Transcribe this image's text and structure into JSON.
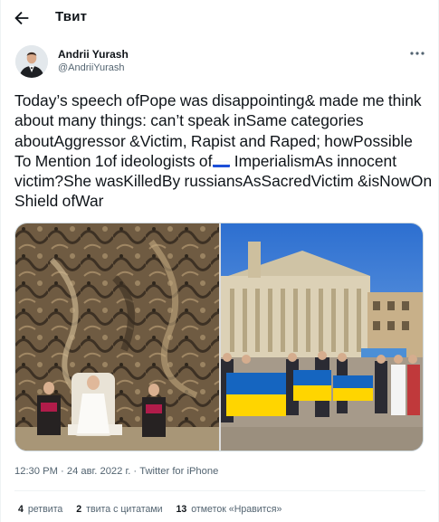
{
  "header": {
    "title": "Твит"
  },
  "author": {
    "name": "Andrii Yurash",
    "handle": "@AndriiYurash"
  },
  "tweet": {
    "text_main": "Today’s speech ofPope was disappointing& made me think about many things: can’t speak inSame categories aboutAggressor &Victim, Rapist and Raped; howPossible To Mention 1of ideologists of",
    "text_tail": " ImperialismAs innocent victim?She wasKilledBy russiansAsSacredVictim &isNowOn Shield ofWar"
  },
  "meta": {
    "time": "12:30 PM",
    "date": "24 авг. 2022 г.",
    "separator": " · ",
    "source": "Twitter for iPhone"
  },
  "stats": {
    "retweets_count": "4",
    "retweets_label": "ретвита",
    "quotes_count": "2",
    "quotes_label": "твита с цитатами",
    "likes_count": "13",
    "likes_label": "отметок «Нравится»"
  },
  "colors": {
    "text": "#0f1419",
    "secondary": "#536471",
    "divider": "#eff3f4",
    "ukraine_blue": "#1565c0",
    "ukraine_yellow": "#ffd500"
  },
  "icons": {
    "back": "arrow-left-icon",
    "more": "more-dots-icon",
    "flag": "russia-flag-emoji"
  }
}
